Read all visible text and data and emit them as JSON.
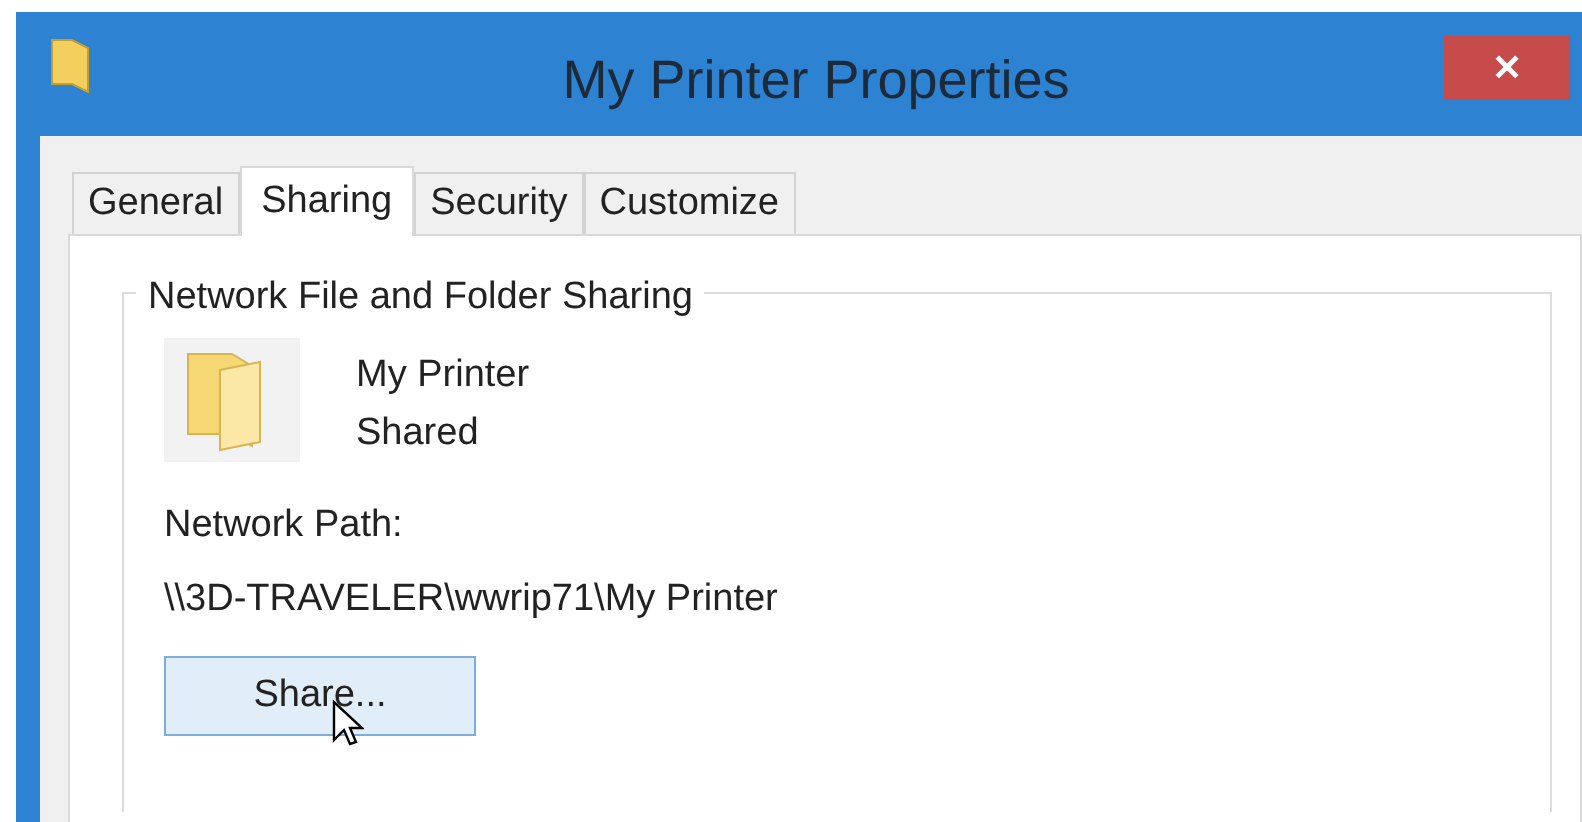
{
  "window": {
    "title": "My Printer Properties",
    "close": "✕"
  },
  "tabs": [
    {
      "label": "General",
      "selected": false
    },
    {
      "label": "Sharing",
      "selected": true
    },
    {
      "label": "Security",
      "selected": false
    },
    {
      "label": "Customize",
      "selected": false
    }
  ],
  "group": {
    "title": "Network File and Folder Sharing",
    "name": "My Printer",
    "status": "Shared",
    "path_label": "Network Path:",
    "path": "\\\\3D-TRAVELER\\wwrip71\\My Printer",
    "button": "Share..."
  }
}
